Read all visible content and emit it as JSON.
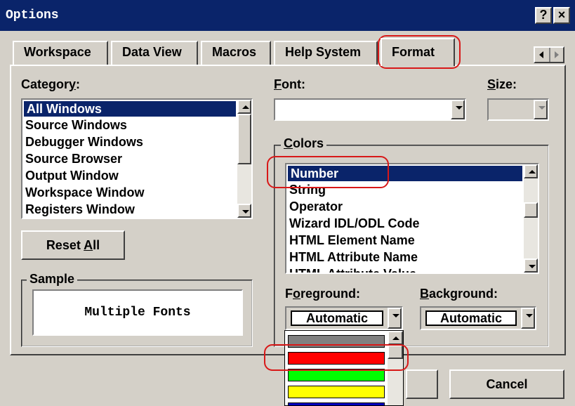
{
  "window": {
    "title": "Options",
    "help_label": "?",
    "close_label": "×"
  },
  "tabs": [
    "Workspace",
    "Data View",
    "Macros",
    "Help System",
    "Format"
  ],
  "category": {
    "label_prefix": "Categor",
    "label_hotkey": "y",
    "label_suffix": ":",
    "items": [
      "All Windows",
      "Source Windows",
      "Debugger Windows",
      "Source Browser",
      "Output Window",
      "Workspace Window",
      "Registers Window"
    ]
  },
  "reset_button": {
    "prefix": "Reset ",
    "hotkey": "A",
    "suffix": "ll"
  },
  "sample": {
    "label": "Sample",
    "text": "Multiple Fonts"
  },
  "font": {
    "label_hotkey": "F",
    "label_suffix": "ont:",
    "value": ""
  },
  "size": {
    "label_hotkey": "S",
    "label_suffix": "ize:",
    "value": ""
  },
  "colors": {
    "label_hotkey": "C",
    "label_suffix": "olors",
    "items": [
      "Number",
      "String",
      "Operator",
      "Wizard IDL/ODL Code",
      "HTML Element Name",
      "HTML Attribute Name",
      "HTML Attribute Value"
    ]
  },
  "foreground": {
    "label_prefix": "F",
    "label_hotkey": "o",
    "label_suffix": "reground:",
    "value": "Automatic"
  },
  "background": {
    "label_hotkey": "B",
    "label_suffix": "ackground:",
    "value": "Automatic"
  },
  "color_dropdown": {
    "swatches": [
      "#808080",
      "#ff0000",
      "#00ff00",
      "#ffff00",
      "#0000c0"
    ]
  },
  "buttons": {
    "cancel": "Cancel"
  }
}
